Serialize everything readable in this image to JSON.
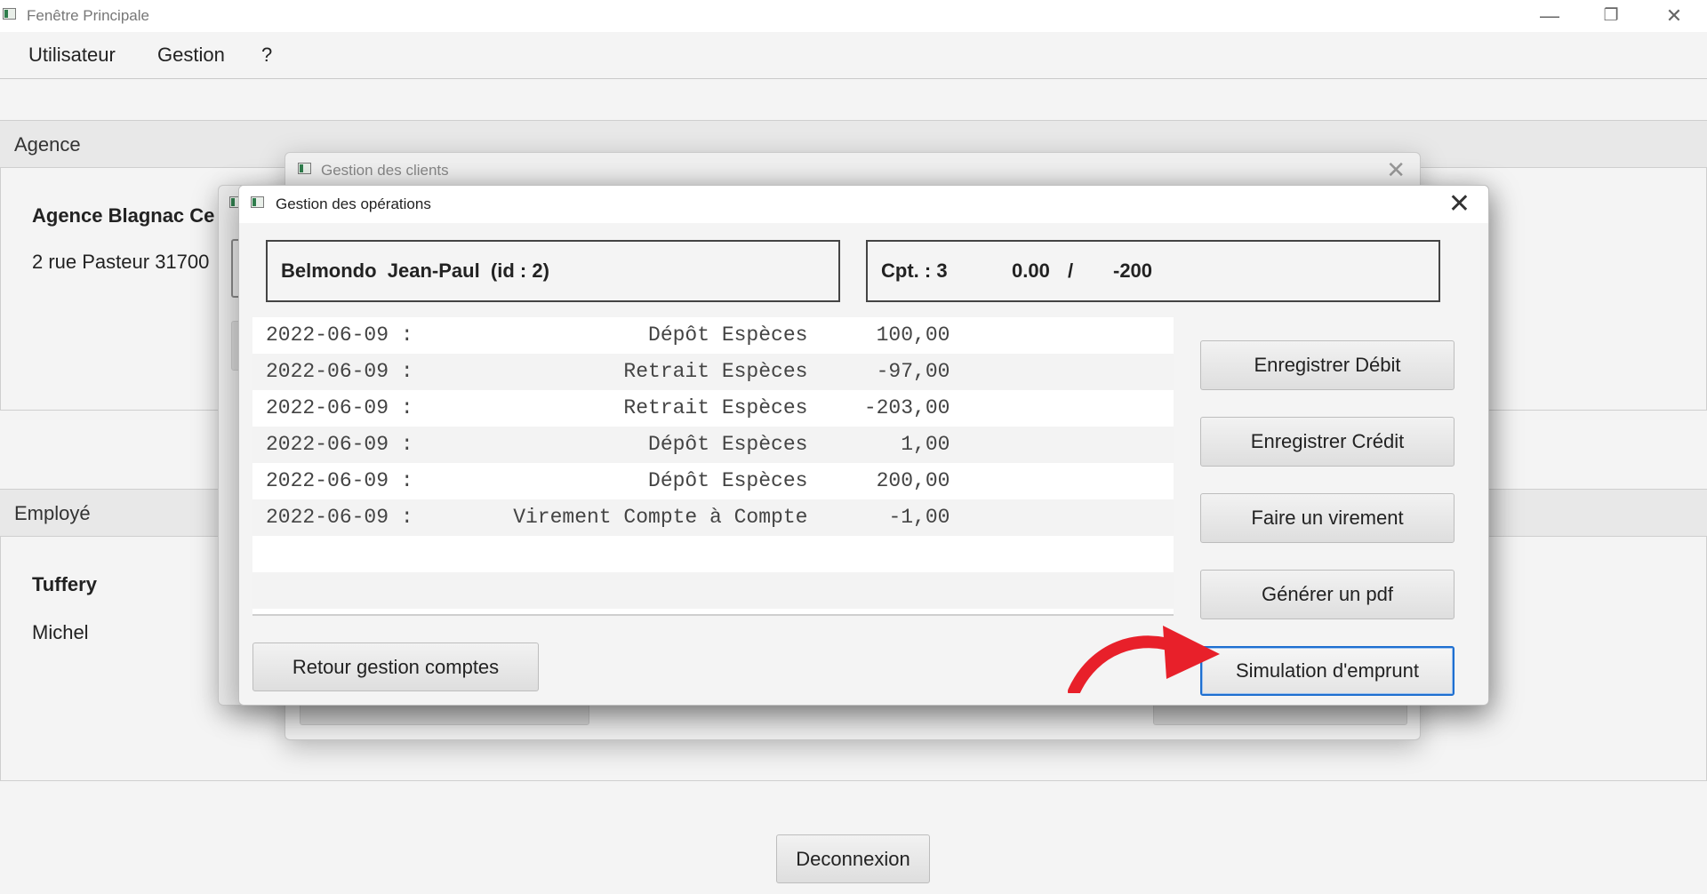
{
  "window": {
    "title": "Fenêtre Principale",
    "controls": {
      "minimize": "—",
      "restore": "❐",
      "close": "✕"
    }
  },
  "menu": [
    "Utilisateur",
    "Gestion",
    "?"
  ],
  "agence": {
    "header": "Agence",
    "name": "Agence Blagnac Ce",
    "address": "2 rue Pasteur 31700"
  },
  "employe": {
    "header": "Employé",
    "lastname": "Tuffery",
    "firstname": "Michel"
  },
  "deconnexion_label": "Deconnexion",
  "clients_dialog": {
    "title": "Gestion des clients",
    "close": "✕"
  },
  "operations_dialog": {
    "title": "Gestion des opérations",
    "close": "✕",
    "client_info": "Belmondo  Jean-Paul  (id : 2)",
    "account": {
      "label": "Cpt. : 3",
      "balance": "0.00",
      "separator": "/",
      "overdraft": "-200"
    },
    "operations": [
      {
        "date": "2022-06-09",
        "type": "Dépôt Espèces",
        "amount": "100,00"
      },
      {
        "date": "2022-06-09",
        "type": "Retrait Espèces",
        "amount": "-97,00"
      },
      {
        "date": "2022-06-09",
        "type": "Retrait Espèces",
        "amount": "-203,00"
      },
      {
        "date": "2022-06-09",
        "type": "Dépôt Espèces",
        "amount": "1,00"
      },
      {
        "date": "2022-06-09",
        "type": "Dépôt Espèces",
        "amount": "200,00"
      },
      {
        "date": "2022-06-09",
        "type": "Virement Compte à Compte",
        "amount": "-1,00"
      }
    ],
    "buttons": {
      "debit": "Enregistrer Débit",
      "credit": "Enregistrer Crédit",
      "virement": "Faire un virement",
      "pdf": "Générer un pdf",
      "simulation": "Simulation d'emprunt",
      "retour": "Retour gestion comptes"
    }
  },
  "colors": {
    "focus": "#1e6fd0",
    "arrow": "#e8202a",
    "app_icon": "#2f7d4c"
  }
}
